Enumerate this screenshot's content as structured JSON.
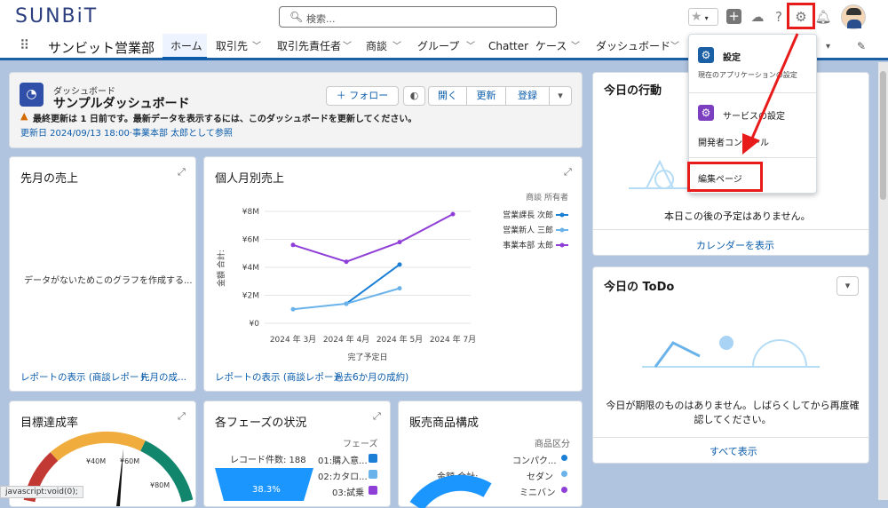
{
  "header": {
    "logo": "SUNBiT",
    "search_placeholder": "検索..."
  },
  "nav": {
    "app_name": "サンビット営業部",
    "tabs": [
      {
        "label": "ホーム",
        "active": true
      },
      {
        "label": "取引先"
      },
      {
        "label": "取引先責任者"
      },
      {
        "label": "商談"
      },
      {
        "label": "グループ"
      },
      {
        "label": "Chatter"
      },
      {
        "label": "ケース"
      },
      {
        "label": "ダッシュボード"
      }
    ]
  },
  "dashboard": {
    "kind": "ダッシュボード",
    "title": "サンプルダッシュボード",
    "warning": "最終更新は 1 日前です。最新データを表示するには、このダッシュボードを更新してください。",
    "updated": "更新日 2024/09/13 18:00·事業本部 太郎として参照",
    "follow": "フォロー",
    "open": "開く",
    "refresh": "更新",
    "subscribe": "登録"
  },
  "card_last_month": {
    "title": "先月の売上",
    "empty": "データがないためこのグラフを作成する...",
    "link1": "レポートの表示 (商談レポート",
    "link2": "先月の成..."
  },
  "card_personal": {
    "title": "個人月別売上",
    "legend_title": "商談 所有者",
    "link1": "レポートの表示 (商談レポート",
    "link2": "過去6か月の成約)"
  },
  "chart_data": {
    "type": "line",
    "title": "個人月別売上",
    "xlabel": "完了予定日",
    "ylabel": "金額 合計:",
    "categories": [
      "2024 年 3月",
      "2024 年 4月",
      "2024 年 5月",
      "2024 年 7月"
    ],
    "ylim": [
      0,
      8
    ],
    "yticks": [
      "¥0",
      "¥2M",
      "¥4M",
      "¥6M",
      "¥8M"
    ],
    "series": [
      {
        "name": "営業課長 次郎",
        "color": "#1b7fd6",
        "values": [
          null,
          1.4,
          4.2,
          null
        ]
      },
      {
        "name": "営業新人 三郎",
        "color": "#6ab2ea",
        "values": [
          1.0,
          1.4,
          2.5,
          null
        ]
      },
      {
        "name": "事業本部 太郎",
        "color": "#8f3fd8",
        "values": [
          5.6,
          4.4,
          5.8,
          7.8
        ]
      }
    ]
  },
  "card_goal": {
    "title": "目標達成率",
    "ticks": [
      "¥40M",
      "¥60M",
      "¥80M"
    ]
  },
  "card_phase": {
    "title": "各フェーズの状況",
    "legend_title": "フェーズ",
    "record": "レコード件数: 188",
    "pct": "38.3%",
    "items": [
      {
        "label": "01:購入意...",
        "color": "#1b7fd6"
      },
      {
        "label": "02:カタロ...",
        "color": "#6ab2ea"
      },
      {
        "label": "03:試乗",
        "color": "#8f3fd8"
      }
    ]
  },
  "card_products": {
    "title": "販売商品構成",
    "legend_title": "商品区分",
    "total": "金額 合計:",
    "items": [
      {
        "label": "コンパク...",
        "color": "#1b7fd6"
      },
      {
        "label": "セダン",
        "color": "#6ab2ea"
      },
      {
        "label": "ミニバン",
        "color": "#8f3fd8"
      }
    ]
  },
  "today_actions": {
    "title": "今日の行動",
    "empty": "本日この後の予定はありません。",
    "link": "カレンダーを表示"
  },
  "today_todo": {
    "title": "今日の ToDo",
    "empty": "今日が期限のものはありません。しばらくしてから再度確認してください。",
    "link": "すべて表示"
  },
  "dropdown": {
    "settings": "設定",
    "settings_sub": "現在のアプリケーションの設定",
    "service": "サービスの設定",
    "dev_console": "開発者コンソール",
    "edit_page": "編集ページ"
  },
  "status_bar": "javascript:void(0);"
}
